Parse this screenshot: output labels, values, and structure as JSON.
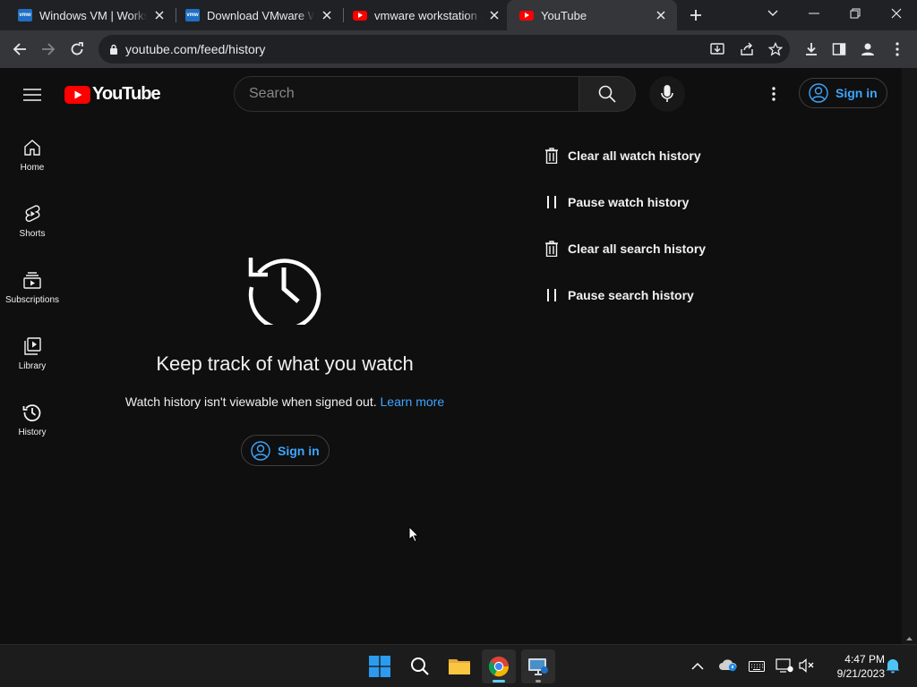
{
  "browser": {
    "tabs": [
      {
        "title": "Windows VM | Workstation",
        "icon": "vmware-icon",
        "active": false
      },
      {
        "title": "Download VMware Workstation",
        "icon": "vmware-icon",
        "active": false
      },
      {
        "title": "vmware workstation pro",
        "icon": "youtube-icon",
        "active": false
      },
      {
        "title": "YouTube",
        "icon": "youtube-icon",
        "active": true
      }
    ],
    "url": "youtube.com/feed/history"
  },
  "youtube": {
    "logo_text": "YouTube",
    "search_placeholder": "Search",
    "signin_label": "Sign in",
    "sidebar": [
      {
        "label": "Home",
        "icon": "home-icon"
      },
      {
        "label": "Shorts",
        "icon": "shorts-icon"
      },
      {
        "label": "Subscriptions",
        "icon": "subscriptions-icon"
      },
      {
        "label": "Library",
        "icon": "library-icon"
      },
      {
        "label": "History",
        "icon": "history-icon"
      }
    ],
    "empty_state": {
      "title": "Keep track of what you watch",
      "message": "Watch history isn't viewable when signed out.",
      "link": "Learn more",
      "signin_label": "Sign in"
    },
    "actions": [
      {
        "label": "Clear all watch history",
        "icon": "trash-icon"
      },
      {
        "label": "Pause watch history",
        "icon": "pause-icon"
      },
      {
        "label": "Clear all search history",
        "icon": "trash-icon"
      },
      {
        "label": "Pause search history",
        "icon": "pause-icon"
      }
    ]
  },
  "taskbar": {
    "time": "4:47 PM",
    "date": "9/21/2023"
  },
  "colors": {
    "accent_blue": "#3ea6ff",
    "youtube_red": "#ff0000",
    "background": "#0f0f0f"
  }
}
